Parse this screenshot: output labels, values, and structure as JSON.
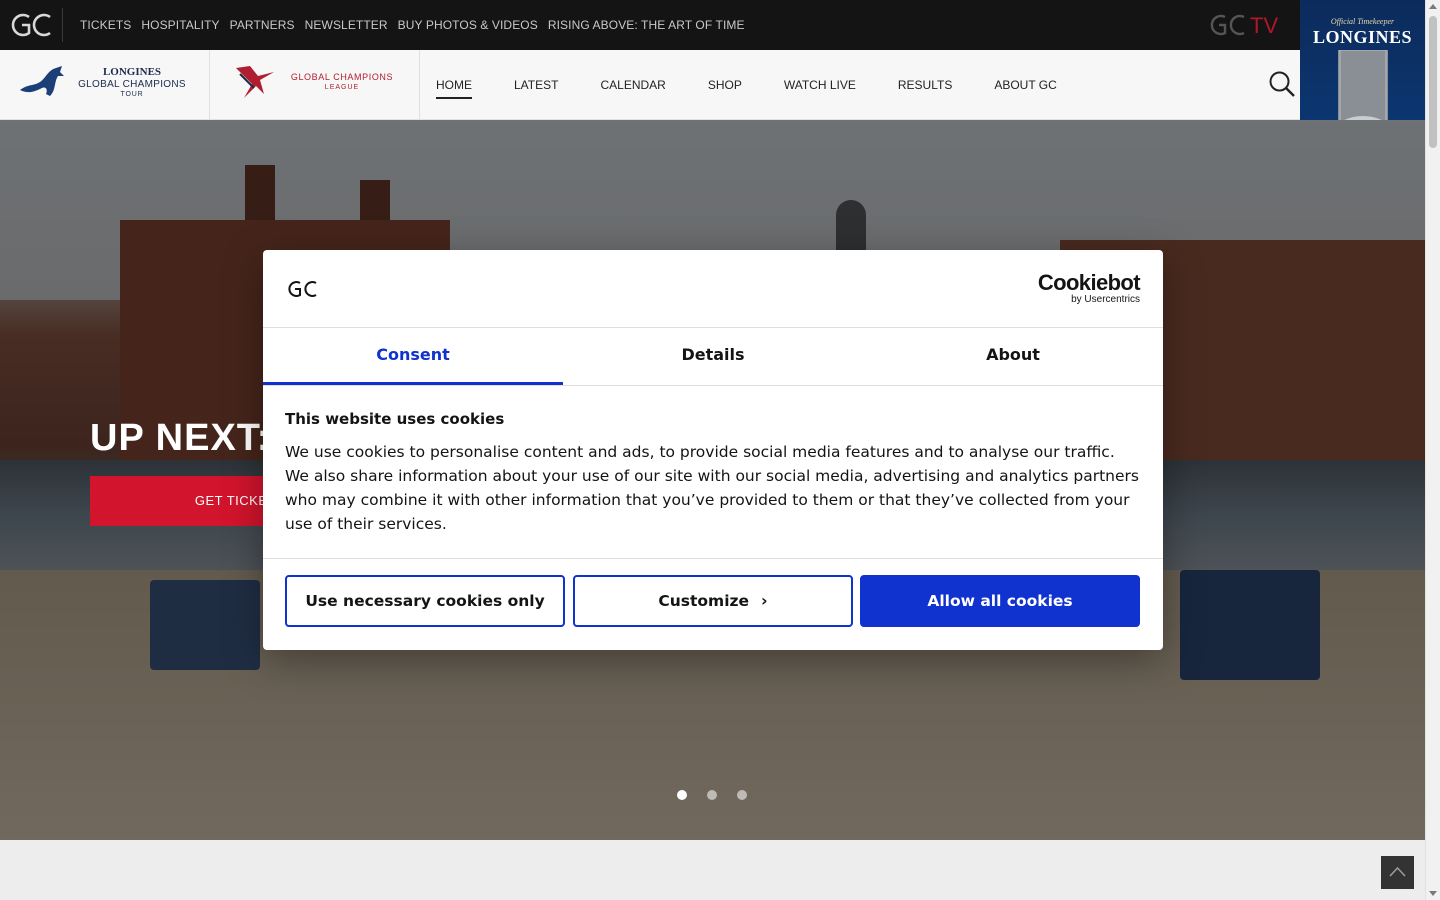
{
  "topbar": {
    "links": [
      "TICKETS",
      "HOSPITALITY",
      "PARTNERS",
      "NEWSLETTER",
      "BUY PHOTOS & VIDEOS",
      "RISING ABOVE: THE ART OF TIME"
    ],
    "tv_label": "TV"
  },
  "ad": {
    "tagline": "Official Timekeeper",
    "brand": "LONGINES"
  },
  "header": {
    "tour_logo": {
      "line1": "LONGINES",
      "line2": "GLOBAL CHAMPIONS",
      "line3": "TOUR"
    },
    "league_logo": {
      "line1": "GLOBAL CHAMPIONS",
      "line2": "LEAGUE"
    },
    "nav": [
      "HOME",
      "LATEST",
      "CALENDAR",
      "SHOP",
      "WATCH LIVE",
      "RESULTS",
      "ABOUT GC"
    ],
    "active_nav": "HOME"
  },
  "hero": {
    "heading": "UP NEXT:",
    "cta_label": "GET TICKETS",
    "slides": 3,
    "active_slide": 1
  },
  "cookie_dialog": {
    "provider_name": "Cookiebot",
    "provider_by": "by Usercentrics",
    "tabs": [
      "Consent",
      "Details",
      "About"
    ],
    "active_tab": "Consent",
    "title": "This website uses cookies",
    "body": "We use cookies to personalise content and ads, to provide social media features and to analyse our traffic. We also share information about your use of our site with our social media, advertising and analytics partners who may combine it with other information that you’ve provided to them or that they’ve collected from your use of their services.",
    "buttons": {
      "necessary": "Use necessary cookies only",
      "customize": "Customize",
      "allow": "Allow all cookies"
    }
  },
  "colors": {
    "accent_blue": "#1032cf",
    "cta_red": "#d2142c",
    "topbar_bg": "#141414",
    "league_red": "#b11e2f",
    "tour_navy": "#1c2b4d"
  },
  "icons": [
    "gc-logo-icon",
    "gctv-logo-icon",
    "search-icon",
    "chevron-right-icon",
    "arrow-up-icon",
    "horse-icon"
  ]
}
